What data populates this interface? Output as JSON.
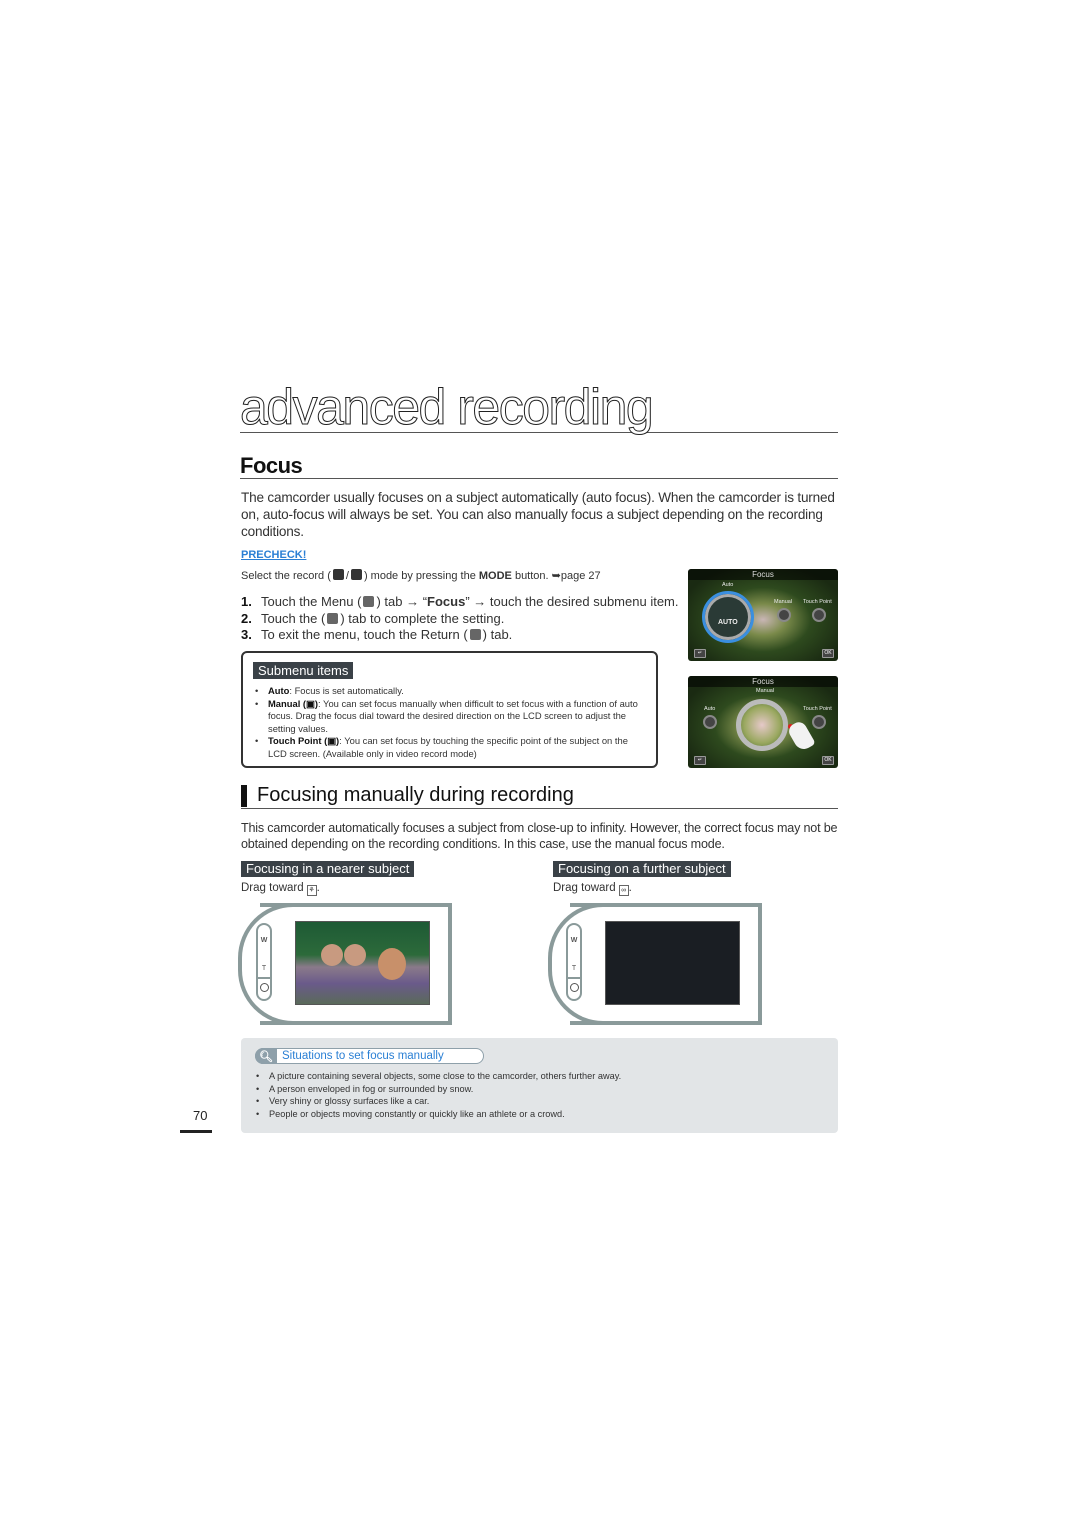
{
  "chapter": {
    "title": "advanced recording"
  },
  "section": {
    "title": "Focus",
    "intro": "The camcorder usually focuses on a subject automatically (auto focus). When the camcorder is turned on, auto-focus will always be set. You can also manually focus a subject depending on the recording conditions."
  },
  "precheck": {
    "label": "PRECHECK!",
    "line_prefix": "Select the record (",
    "line_mid": ") mode by pressing the ",
    "mode_word": "MODE",
    "line_suffix": " button. ➥page 27"
  },
  "steps": [
    {
      "num": "1.",
      "parts": [
        "Touch the Menu (",
        ") tab → “",
        "Focus",
        "” → touch the desired submenu item."
      ]
    },
    {
      "num": "2.",
      "parts": [
        "Touch the (",
        ") tab to complete the setting."
      ]
    },
    {
      "num": "3.",
      "parts": [
        "To exit the menu, touch the Return (",
        ") tab."
      ]
    }
  ],
  "screens": [
    {
      "title": "Focus",
      "labels": [
        "Auto",
        "Manual",
        "Touch Point"
      ],
      "center": "AUTO",
      "return": "↵",
      "ok": "OK"
    },
    {
      "title": "Focus",
      "labels": [
        "Manual",
        "Auto",
        "Touch Point"
      ],
      "return": "↵",
      "ok": "OK"
    }
  ],
  "submenu": {
    "title": "Submenu items",
    "items": [
      {
        "name": "Auto",
        "text": ": Focus is set automatically."
      },
      {
        "name": "Manual (▣)",
        "text": ": You can set focus manually when difficult to set focus with a function of auto focus. Drag the focus dial toward the desired direction on the LCD screen to adjust the setting values."
      },
      {
        "name": "Touch Point (▣)",
        "text": ": You can set focus by touching the specific point of the subject on the LCD screen. (Available only in video record mode)"
      }
    ]
  },
  "manual_section": {
    "title": "Focusing manually during recording",
    "body": "This camcorder automatically focuses a subject from close-up to infinity. However, the correct focus may not be obtained depending on the recording conditions. In this case, use the manual focus mode.",
    "nearer": {
      "title": "Focusing in a nearer subject",
      "drag": "Drag toward",
      "icon": "⚘"
    },
    "further": {
      "title": "Focusing on a further subject",
      "drag": "Drag toward",
      "icon": "∞"
    },
    "device_labels": {
      "w": "W",
      "t": "T"
    }
  },
  "tips": {
    "title": "Situations to set focus manually",
    "items": [
      "A picture containing several objects, some close to the camcorder, others further away.",
      "A person enveloped in fog or surrounded by snow.",
      "Very shiny or glossy surfaces like a car.",
      "People or objects moving constantly or quickly like an athlete or a crowd."
    ]
  },
  "page_number": "70",
  "colors": {
    "accent_blue": "#2a7fd4",
    "tag_bg": "#3a4147",
    "tip_bg": "#e2e5e7",
    "device_frame": "#8a9a9a"
  }
}
